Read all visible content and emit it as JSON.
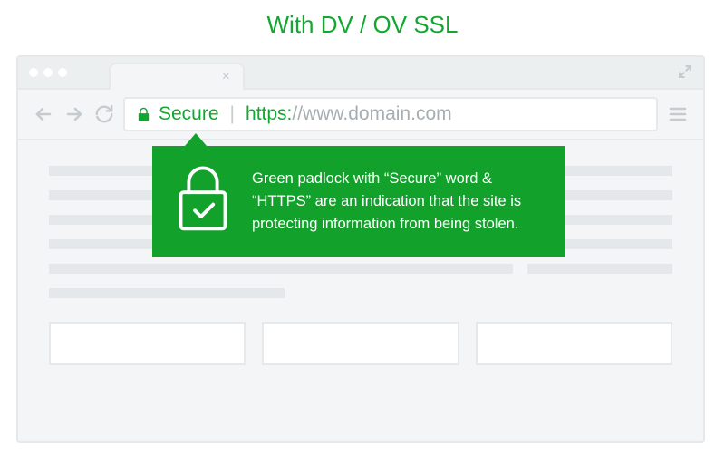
{
  "title": "With DV / OV SSL",
  "tab": {
    "close_glyph": "×"
  },
  "addressbar": {
    "secure_label": "Secure",
    "separator": "|",
    "protocol": "https:",
    "rest": "//www.domain.com"
  },
  "tooltip": {
    "text": "Green padlock with “Secure” word & “HTTPS” are an indication that the site is protecting information from being stolen."
  },
  "colors": {
    "accent": "#12a730",
    "tooltip_bg": "#12a12b",
    "chrome_line": "#e6e8ea",
    "muted": "#c6cbce"
  }
}
